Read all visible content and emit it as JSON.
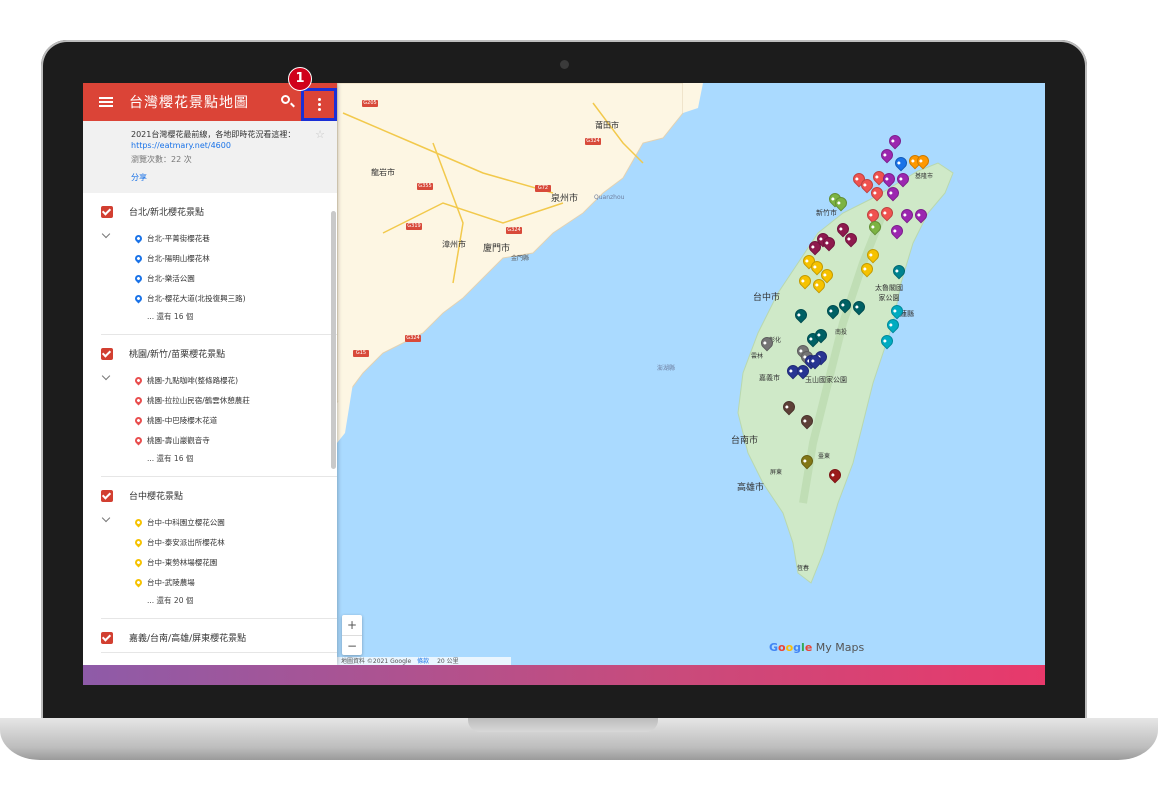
{
  "app": {
    "title": "台灣櫻花景點地圖"
  },
  "step_badge": "1",
  "info": {
    "description": "2021台灣櫻花最前線，各地即時花況看這裡：",
    "link": "https://eatmary.net/4600",
    "views": "瀏覽次數：22 次",
    "share": "分享"
  },
  "layers": [
    {
      "name": "台北/新北櫻花景點",
      "pin_color": "#1a73e8",
      "items": [
        "台北-平菁街櫻花巷",
        "台北-陽明山櫻花林",
        "台北-樂活公園",
        "台北-櫻花大道(北投復興三路)"
      ],
      "more": "... 還有 16 個"
    },
    {
      "name": "桃園/新竹/苗栗櫻花景點",
      "pin_color": "#e84d4d",
      "items": [
        "桃園-九點咖啡(整條路櫻花)",
        "桃園-拉拉山民宿/鶴雲休憩農莊",
        "桃園-中巴陵櫻木花道",
        "桃園-壽山巖觀音寺"
      ],
      "more": "... 還有 16 個"
    },
    {
      "name": "台中櫻花景點",
      "pin_color": "#f6c200",
      "items": [
        "台中-中科園立櫻花公園",
        "台中-泰安派出所櫻花林",
        "台中-東勢林場櫻花園",
        "台中-武陵農場"
      ],
      "more": "... 還有 20 個"
    },
    {
      "name": "嘉義/台南/高雄/屏東櫻花景點",
      "pin_color": "#1a237e",
      "items": [],
      "more": ""
    }
  ],
  "map": {
    "labels": {
      "putian": "莆田市",
      "quanzhou": "泉州市",
      "quanzhou_en": "Quanzhou",
      "zhangzhou": "漳州市",
      "xiamen": "廈門市",
      "jinmen": "金門縣",
      "penghu": "澎湖縣",
      "longyan": "龍岩市",
      "hsinchu": "新竹市",
      "taichung": "台中市",
      "chiayi": "嘉義市",
      "tainan": "台南市",
      "kaohsiung": "高雄市",
      "yushan": "玉山國家公園",
      "taroko": "太魯閣國家公園",
      "hualien": "花蓮縣",
      "taitung": "臺東",
      "pingtung": "屏東",
      "nantou": "南投",
      "changhua": "彰化",
      "yunlin": "雲林",
      "hengchun": "恆春",
      "keelung": "基隆市"
    },
    "roads": [
      "G205",
      "G324",
      "G355",
      "G72",
      "G319",
      "G324",
      "G324",
      "G15"
    ],
    "zoom_in": "+",
    "zoom_out": "−",
    "footer_data": "地圖資料 ©2021 Google",
    "footer_terms": "條款",
    "footer_scale": "20 公里",
    "logo_parts": [
      "G",
      "o",
      "o",
      "g",
      "l",
      "e"
    ],
    "logo_suffix": " My Maps"
  },
  "colors": {
    "accent": "#db4437",
    "highlight": "#1a2fd6",
    "badge": "#d0021b",
    "sea": "#aadaff",
    "land": "#fff8e6",
    "island": "#cfe9c8"
  }
}
